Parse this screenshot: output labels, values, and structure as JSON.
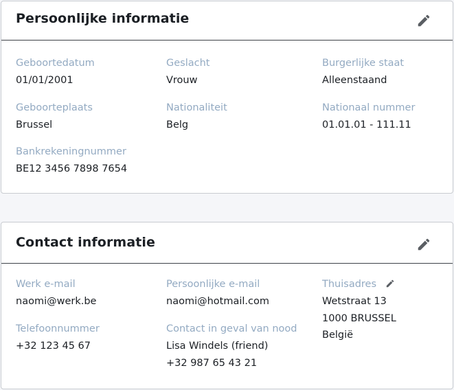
{
  "personal": {
    "title": "Persoonlijke informatie",
    "fields": {
      "birthdate": {
        "label": "Geboortedatum",
        "value": "01/01/2001"
      },
      "gender": {
        "label": "Geslacht",
        "value": "Vrouw"
      },
      "civil_status": {
        "label": "Burgerlijke staat",
        "value": "Alleenstaand"
      },
      "birthplace": {
        "label": "Geboorteplaats",
        "value": "Brussel"
      },
      "nationality": {
        "label": "Nationaliteit",
        "value": "Belg"
      },
      "national_number": {
        "label": "Nationaal nummer",
        "value": "01.01.01 - 111.11"
      },
      "bank_account": {
        "label": "Bankrekeningnummer",
        "value": "BE12 3456 7898 7654"
      }
    }
  },
  "contact": {
    "title": "Contact informatie",
    "fields": {
      "work_email": {
        "label": "Werk e-mail",
        "value": "naomi@werk.be"
      },
      "personal_email": {
        "label": "Persoonlijke e-mail",
        "value": "naomi@hotmail.com"
      },
      "home_address": {
        "label": "Thuisadres",
        "lines": [
          "Wetstraat 13",
          "1000 BRUSSEL",
          "België"
        ]
      },
      "phone": {
        "label": "Telefoonnummer",
        "value": "+32 123 45 67"
      },
      "emergency_contact": {
        "label": "Contact in geval van nood",
        "lines": [
          "Lisa Windels (friend)",
          "+32 987 65 43 21"
        ]
      }
    }
  },
  "icons": {
    "edit": "pencil-icon"
  },
  "colors": {
    "label": "#93aac2",
    "text": "#1b1f24",
    "icon": "#5a5e63",
    "background": "#f5f6f9"
  }
}
